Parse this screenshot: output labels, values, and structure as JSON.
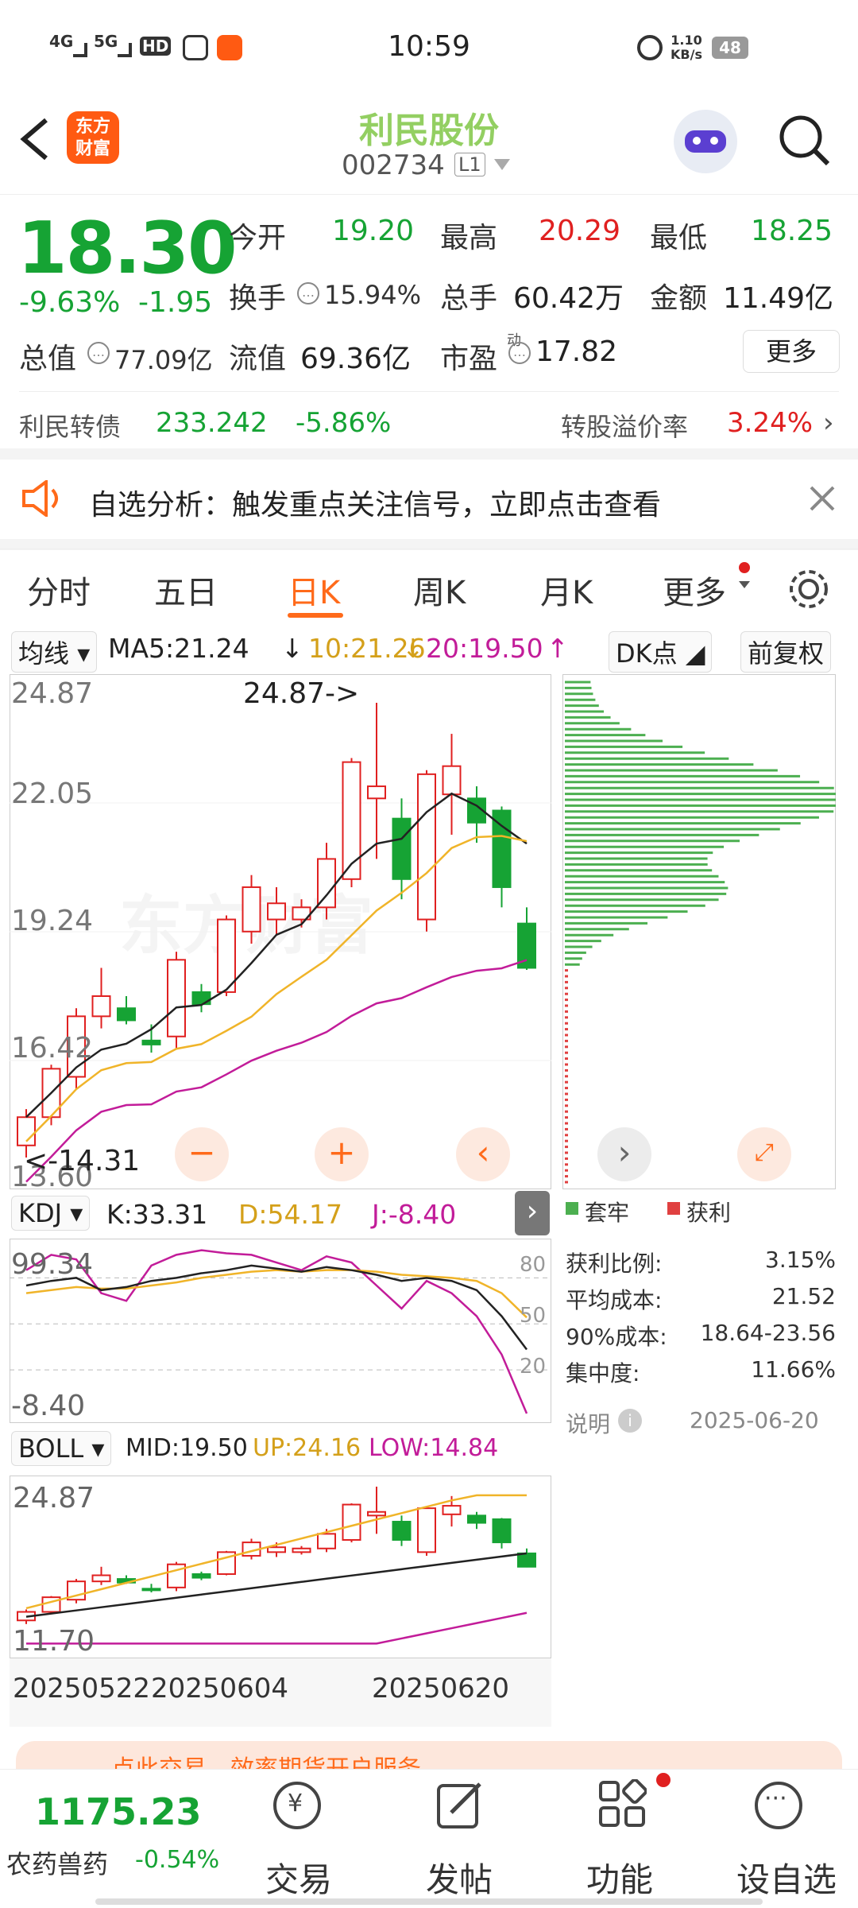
{
  "status_bar": {
    "time": "10:59",
    "network1": "4G",
    "network2": "5G",
    "hd": "HD",
    "speed_value": "1.10",
    "speed_unit": "KB/s",
    "battery": "48"
  },
  "header": {
    "title": "利民股份",
    "code": "002734",
    "level": "L1",
    "logo_line1": "东方",
    "logo_line2": "财富"
  },
  "quote": {
    "price": "18.30",
    "change_pct": "-9.63%",
    "change": "-1.95",
    "open_label": "今开",
    "open": "19.20",
    "high_label": "最高",
    "high": "20.29",
    "low_label": "最低",
    "low": "18.25",
    "turnover_label": "换手",
    "turnover": "15.94%",
    "volume_label": "总手",
    "volume": "60.42万",
    "amount_label": "金额",
    "amount": "11.49亿",
    "mcap_label": "总值",
    "mcap": "77.09亿",
    "float_label": "流值",
    "float": "69.36亿",
    "pe_label": "市盈",
    "pe_sup": "动",
    "pe": "17.82",
    "more_label": "更多"
  },
  "bond": {
    "name": "利民转债",
    "price": "233.242",
    "change": "-5.86%",
    "premium_label": "转股溢价率",
    "premium": "3.24%"
  },
  "notice": {
    "text": "自选分析：触发重点关注信号，立即点击查看"
  },
  "tabs": [
    "分时",
    "五日",
    "日K",
    "周K",
    "月K",
    "更多"
  ],
  "ma_bar": {
    "selector": "均线",
    "ma5": "MA5:21.24",
    "ma10": "10:21.26",
    "ma20": "20:19.50",
    "dk": "DK点",
    "adjust": "前复权"
  },
  "kline": {
    "y_labels": [
      "24.87",
      "22.05",
      "19.24",
      "16.42",
      "13.60"
    ],
    "max_marker": "24.87->",
    "min_marker": "<-14.31",
    "watermark": "东方财富"
  },
  "kdj_bar": {
    "selector": "KDJ",
    "k": "K:33.31",
    "d": "D:54.17",
    "j": "J:-8.40"
  },
  "kdj": {
    "top_label": "99.34",
    "bottom_label": "-8.40",
    "levels": [
      "80",
      "50",
      "20"
    ]
  },
  "boll_bar": {
    "selector": "BOLL",
    "mid": "MID:19.50",
    "up": "UP:24.16",
    "low": "LOW:14.84"
  },
  "boll": {
    "top_label": "24.87",
    "bottom_label": "11.70"
  },
  "dates": [
    "20250522",
    "20250604",
    "20250620"
  ],
  "chips": {
    "legend_trap": "套牢",
    "legend_profit": "获利",
    "rows": [
      {
        "label": "获利比例:",
        "value": "3.15%"
      },
      {
        "label": "平均成本:",
        "value": "21.52"
      },
      {
        "label": "90%成本:",
        "value": "18.64-23.56"
      },
      {
        "label": "集中度:",
        "value": "11.66%"
      }
    ],
    "explain": "说明",
    "date": "2025-06-20"
  },
  "banner": {
    "text": "点此交易，效率期货开户服务"
  },
  "bottom": {
    "index_value": "1175.23",
    "index_name": "农药兽药",
    "index_change": "-0.54%",
    "items": [
      "交易",
      "发帖",
      "功能",
      "设自选"
    ]
  },
  "colors": {
    "up": "#e02020",
    "down": "#16a334",
    "accent": "#ff6a1a",
    "ma5": "#222222",
    "ma10": "#f0b429",
    "ma20": "#c21c99"
  },
  "chart_data": {
    "type": "candlestick",
    "candles": [
      {
        "o": 13.9,
        "h": 14.8,
        "l": 13.6,
        "c": 14.6
      },
      {
        "o": 14.6,
        "h": 15.9,
        "l": 14.4,
        "c": 15.8
      },
      {
        "o": 15.6,
        "h": 17.3,
        "l": 15.3,
        "c": 17.1
      },
      {
        "o": 17.1,
        "h": 18.3,
        "l": 16.8,
        "c": 17.6
      },
      {
        "o": 17.3,
        "h": 17.6,
        "l": 16.9,
        "c": 17.0
      },
      {
        "o": 16.5,
        "h": 16.9,
        "l": 16.2,
        "c": 16.4
      },
      {
        "o": 16.6,
        "h": 18.7,
        "l": 16.3,
        "c": 18.5
      },
      {
        "o": 17.7,
        "h": 17.9,
        "l": 17.2,
        "c": 17.4
      },
      {
        "o": 17.7,
        "h": 19.6,
        "l": 17.6,
        "c": 19.5
      },
      {
        "o": 19.2,
        "h": 20.6,
        "l": 18.9,
        "c": 20.3
      },
      {
        "o": 19.5,
        "h": 20.3,
        "l": 19.1,
        "c": 19.9
      },
      {
        "o": 19.5,
        "h": 20.0,
        "l": 19.3,
        "c": 19.8
      },
      {
        "o": 19.8,
        "h": 21.4,
        "l": 19.5,
        "c": 21.0
      },
      {
        "o": 20.5,
        "h": 23.5,
        "l": 20.3,
        "c": 23.4
      },
      {
        "o": 22.5,
        "h": 24.87,
        "l": 21.0,
        "c": 22.8
      },
      {
        "o": 22.0,
        "h": 22.5,
        "l": 20.0,
        "c": 20.5
      },
      {
        "o": 19.5,
        "h": 23.2,
        "l": 19.2,
        "c": 23.1
      },
      {
        "o": 22.6,
        "h": 24.1,
        "l": 21.6,
        "c": 23.3
      },
      {
        "o": 22.5,
        "h": 22.8,
        "l": 21.4,
        "c": 21.9
      },
      {
        "o": 22.2,
        "h": 22.3,
        "l": 19.8,
        "c": 20.3
      },
      {
        "o": 19.4,
        "h": 19.8,
        "l": 18.25,
        "c": 18.3
      }
    ]
  }
}
